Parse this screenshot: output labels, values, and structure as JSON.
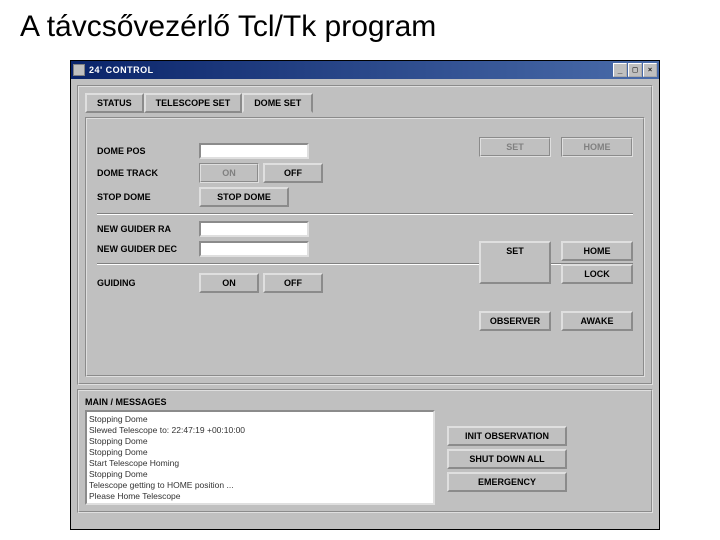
{
  "slide": {
    "title": "A távcsővezérlő Tcl/Tk program"
  },
  "window": {
    "title": "24' CONTROL"
  },
  "tabs": {
    "status": "STATUS",
    "telescope_set": "TELESCOPE SET",
    "dome_set": "DOME SET"
  },
  "dome": {
    "pos_label": "DOME POS",
    "track_label": "DOME TRACK",
    "stop_label": "STOP DOME",
    "on": "ON",
    "off": "OFF",
    "stop_btn": "STOP DOME",
    "set_btn": "SET",
    "home_btn": "HOME",
    "pos_value": ""
  },
  "guider": {
    "ra_label": "NEW GUIDER RA",
    "dec_label": "NEW GUIDER DEC",
    "ra_value": "",
    "dec_value": "",
    "set_btn": "SET",
    "home_btn": "HOME",
    "lock_btn": "LOCK"
  },
  "guiding": {
    "label": "GUIDING",
    "on": "ON",
    "off": "OFF",
    "observer": "OBSERVER",
    "awake": "AWAKE"
  },
  "messages": {
    "header": "MAIN / MESSAGES",
    "lines": [
      "Stopping Dome",
      "Slewed Telescope to: 22:47:19 +00:10:00",
      "Stopping Dome",
      "Stopping Dome",
      "Start Telescope Homing",
      "Stopping Dome",
      "Telescope getting to HOME position ...",
      "Please Home Telescope"
    ],
    "init_btn": "INIT OBSERVATION",
    "shutdown_btn": "SHUT DOWN ALL",
    "emergency_btn": "EMERGENCY"
  }
}
